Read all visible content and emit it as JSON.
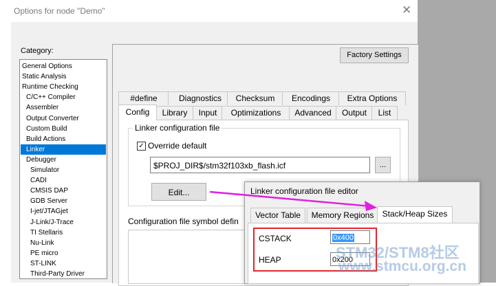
{
  "window": {
    "title": "Options for node \"Demo\"",
    "close_glyph": "✕"
  },
  "category": {
    "label": "Category:",
    "items": [
      {
        "label": "General Options",
        "indent": 0
      },
      {
        "label": "Static Analysis",
        "indent": 0
      },
      {
        "label": "Runtime Checking",
        "indent": 0
      },
      {
        "label": "C/C++ Compiler",
        "indent": 1
      },
      {
        "label": "Assembler",
        "indent": 1
      },
      {
        "label": "Output Converter",
        "indent": 1
      },
      {
        "label": "Custom Build",
        "indent": 1
      },
      {
        "label": "Build Actions",
        "indent": 1
      },
      {
        "label": "Linker",
        "indent": 1,
        "selected": true
      },
      {
        "label": "Debugger",
        "indent": 1
      },
      {
        "label": "Simulator",
        "indent": 2
      },
      {
        "label": "CADI",
        "indent": 2
      },
      {
        "label": "CMSIS DAP",
        "indent": 2
      },
      {
        "label": "GDB Server",
        "indent": 2
      },
      {
        "label": "I-jet/JTAGjet",
        "indent": 2
      },
      {
        "label": "J-Link/J-Trace",
        "indent": 2
      },
      {
        "label": "TI Stellaris",
        "indent": 2
      },
      {
        "label": "Nu-Link",
        "indent": 2
      },
      {
        "label": "PE micro",
        "indent": 2
      },
      {
        "label": "ST-LINK",
        "indent": 2
      },
      {
        "label": "Third-Party Driver",
        "indent": 2
      }
    ]
  },
  "factory_settings": "Factory Settings",
  "tabs_row1": [
    "#define",
    "Diagnostics",
    "Checksum",
    "Encodings",
    "Extra Options"
  ],
  "tabs_row2": [
    "Config",
    "Library",
    "Input",
    "Optimizations",
    "Advanced",
    "Output",
    "List"
  ],
  "active_tab": "Config",
  "linker_group": {
    "title": "Linker configuration file",
    "override_checked": true,
    "override_label": "Override default",
    "path": "$PROJ_DIR$/stm32f103xb_flash.icf",
    "browse_label": "...",
    "edit_label": "Edit..."
  },
  "symbol_defs_label": "Configuration file symbol defin",
  "editor": {
    "title": "Linker configuration file editor",
    "tabs": [
      "Vector Table",
      "Memory Regions",
      "Stack/Heap Sizes"
    ],
    "active_tab": "Stack/Heap Sizes",
    "cstack_label": "CSTACK",
    "cstack_value": "0x400",
    "heap_label": "HEAP",
    "heap_value": "0x200"
  },
  "watermark": {
    "line1": "STM32/STM8社区",
    "line2": "www.stmcu.org.cn"
  },
  "colors": {
    "selection": "#0078d7",
    "highlight_box": "#e0262c",
    "arrow": "#e020e0"
  }
}
